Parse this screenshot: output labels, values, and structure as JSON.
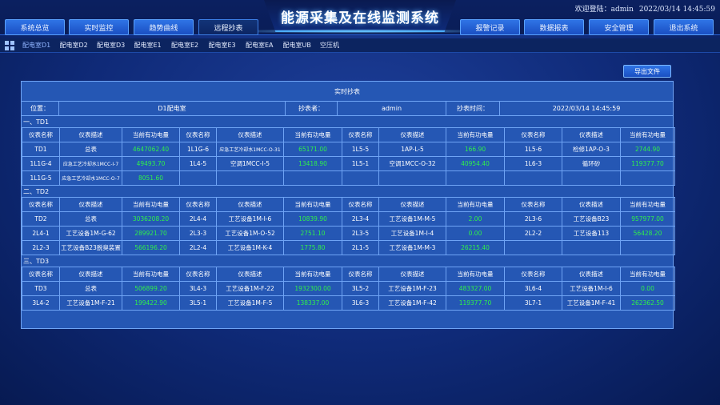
{
  "header": {
    "title": "能源采集及在线监测系统",
    "welcome": "欢迎登陆：admin",
    "datetime": "2022/03/14 14:45:59",
    "nav_left": [
      "系统总览",
      "实时监控",
      "趋势曲线",
      "远程抄表"
    ],
    "nav_right": [
      "报警记录",
      "数据报表",
      "安全管理",
      "退出系统"
    ],
    "active_nav": "远程抄表"
  },
  "subtabs": [
    "配电室D1",
    "配电室D2",
    "配电室D3",
    "配电室E1",
    "配电室E2",
    "配电室E3",
    "配电室EA",
    "配电室UB",
    "空压机"
  ],
  "export_label": "导出文件",
  "panel": {
    "title": "实时抄表",
    "location_label": "位置：",
    "location_value": "D1配电室",
    "reader_label": "抄表者：",
    "reader_value": "admin",
    "time_label": "抄表时间：",
    "time_value": "2022/03/14 14:45:59",
    "columns": [
      "仪表名称",
      "仪表描述",
      "当前有功电量"
    ]
  },
  "sections": [
    {
      "label": "一、TD1",
      "rows": [
        [
          [
            "TD1",
            "总表",
            "4647062.40"
          ],
          [
            "1L1G-6",
            "应急工艺冷却水1MCC-O-31",
            "65171.00"
          ],
          [
            "1L5-5",
            "1AP-L-5",
            "166.90"
          ],
          [
            "1L5-6",
            "检修1AP-O-3",
            "2744.90"
          ]
        ],
        [
          [
            "1L1G-4",
            "应急工艺冷却水1MCC-I-7",
            "49493.70"
          ],
          [
            "1L4-5",
            "空调1MCC-I-5",
            "13418.90"
          ],
          [
            "1L5-1",
            "空调1MCC-O-32",
            "40954.40"
          ],
          [
            "1L6-3",
            "循环砂",
            "119377.70"
          ]
        ],
        [
          [
            "1L1G-5",
            "应急工艺冷却水1MCC-O-7",
            "8051.60"
          ],
          [
            "",
            "",
            ""
          ],
          [
            "",
            "",
            ""
          ],
          [
            "",
            "",
            ""
          ]
        ]
      ]
    },
    {
      "label": "二、TD2",
      "rows": [
        [
          [
            "TD2",
            "总表",
            "3036208.20"
          ],
          [
            "2L4-4",
            "工艺设备1M-I-6",
            "10839.90"
          ],
          [
            "2L3-4",
            "工艺设备1M-M-5",
            "2.00"
          ],
          [
            "2L3-6",
            "工艺设备B23",
            "957977.00"
          ]
        ],
        [
          [
            "2L4-1",
            "工艺设备1M-G-62",
            "289921.70"
          ],
          [
            "2L3-3",
            "工艺设备1M-O-52",
            "2751.10"
          ],
          [
            "2L3-5",
            "工艺设备1M-I-4",
            "0.00"
          ],
          [
            "2L2-2",
            "工艺设备113",
            "56428.20"
          ]
        ],
        [
          [
            "2L2-3",
            "工艺设备B23脱臭装置",
            "566196.20"
          ],
          [
            "2L2-4",
            "工艺设备1M-K-4",
            "1775.80"
          ],
          [
            "2L1-5",
            "工艺设备1M-M-3",
            "26215.40"
          ],
          [
            "",
            "",
            ""
          ]
        ]
      ]
    },
    {
      "label": "三、TD3",
      "rows": [
        [
          [
            "TD3",
            "总表",
            "506899.20"
          ],
          [
            "3L4-3",
            "工艺设备1M-F-22",
            "1932300.00"
          ],
          [
            "3L5-2",
            "工艺设备1M-F-23",
            "483327.00"
          ],
          [
            "3L6-4",
            "工艺设备1M-I-6",
            "0.00"
          ]
        ],
        [
          [
            "3L4-2",
            "工艺设备1M-F-21",
            "199422.90"
          ],
          [
            "3L5-1",
            "工艺设备1M-F-5",
            "138337.00"
          ],
          [
            "3L6-3",
            "工艺设备1M-F-42",
            "119377.70"
          ],
          [
            "3L7-1",
            "工艺设备1M-F-41",
            "262362.50"
          ]
        ]
      ]
    }
  ]
}
